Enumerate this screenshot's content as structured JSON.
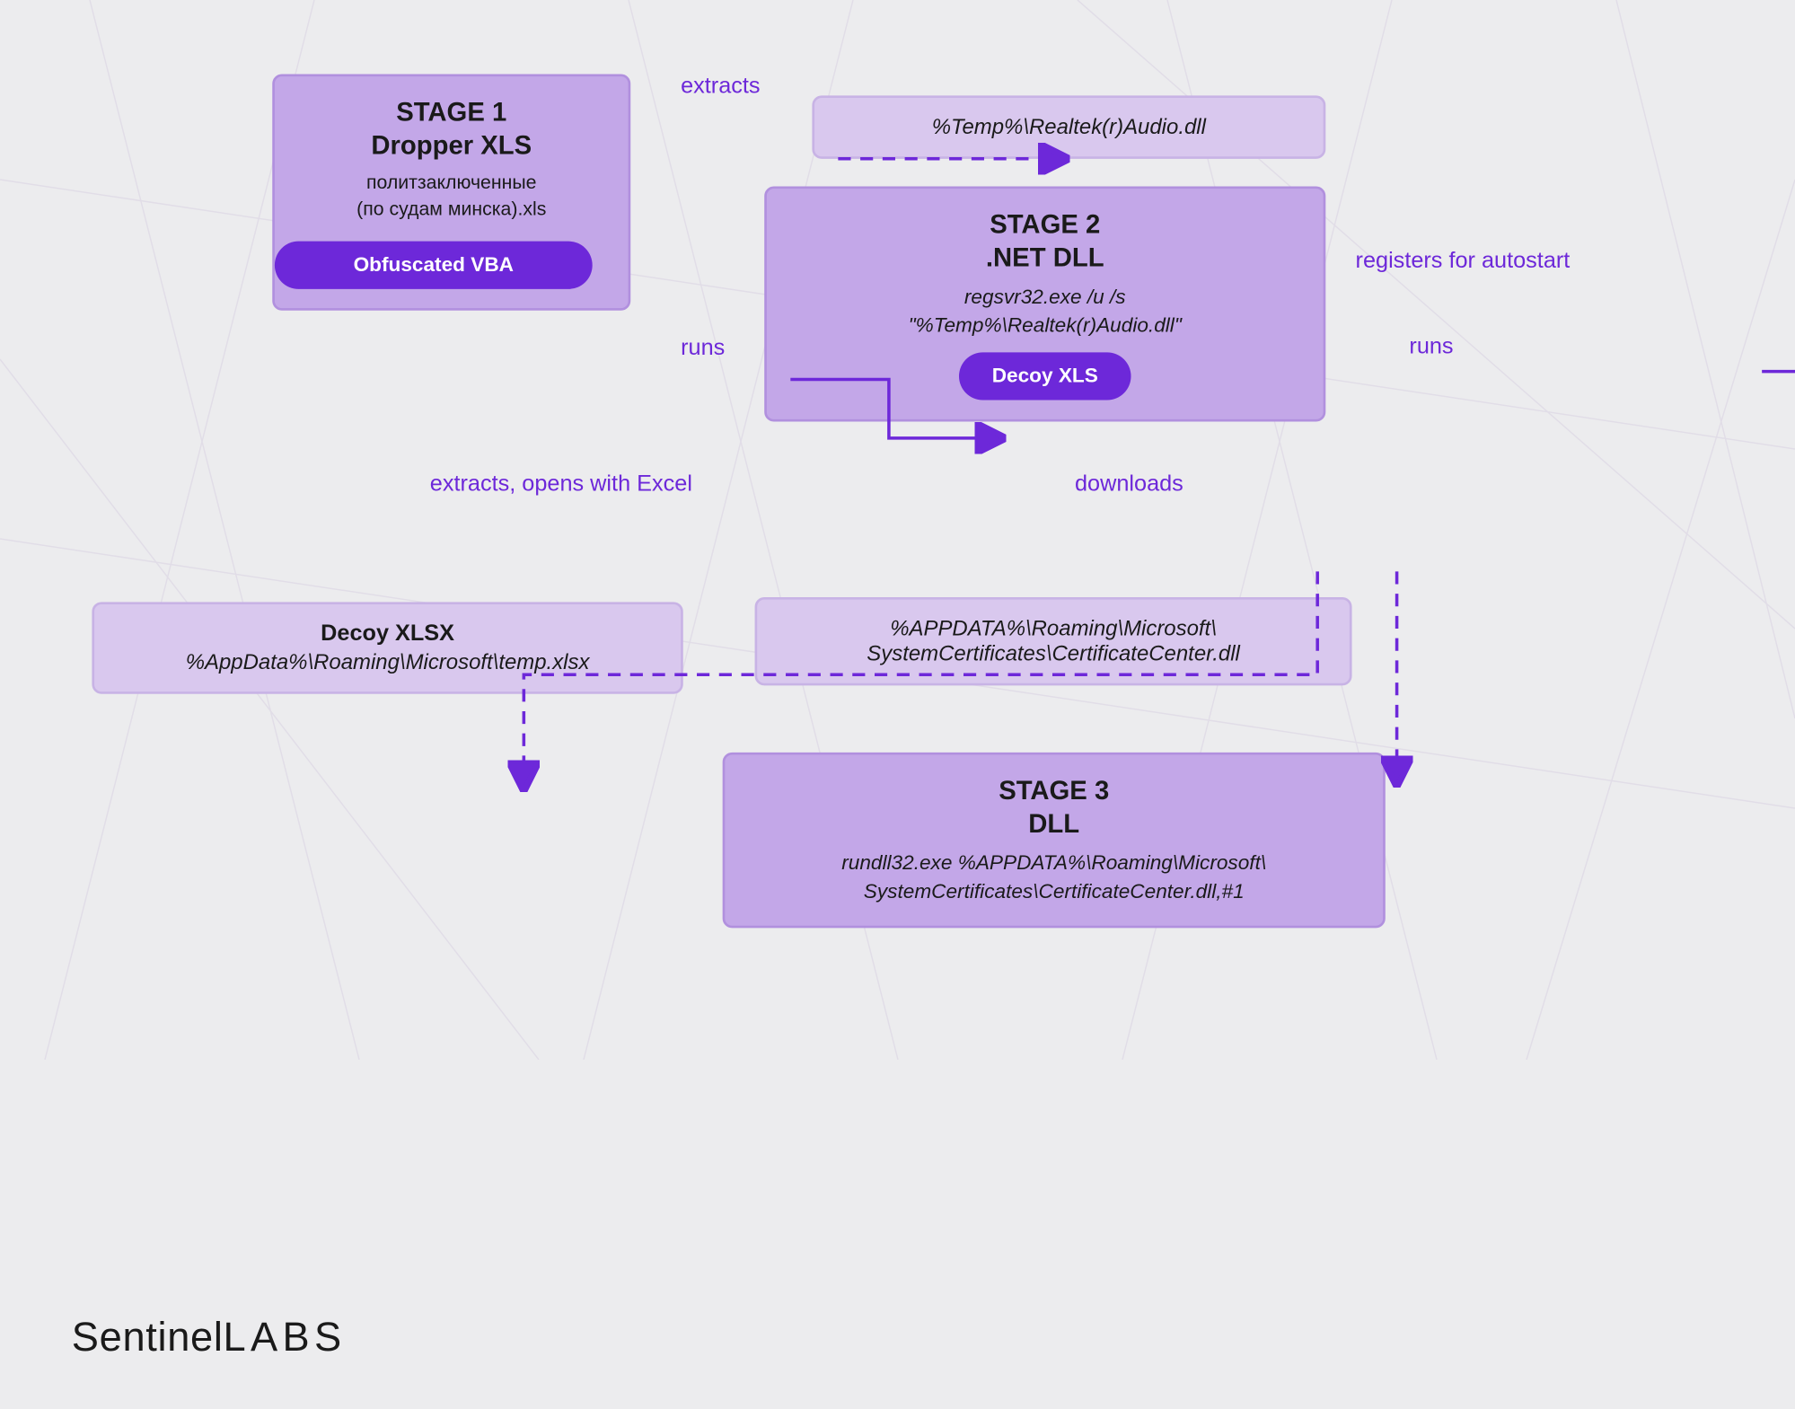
{
  "stage1": {
    "title_line1": "STAGE 1",
    "title_line2": "Dropper XLS",
    "sub_line1": "политзаключенные",
    "sub_line2": "(по судам минска).xls",
    "pill": "Obfuscated VBA"
  },
  "box_realtek": {
    "text": "%Temp%\\Realtek(r)Audio.dll"
  },
  "stage2": {
    "title_line1": "STAGE 2",
    "title_line2": ".NET DLL",
    "sub_line1": "regsvr32.exe /u /s",
    "sub_line2": "\"%Temp%\\Realtek(r)Audio.dll\"",
    "pill": "Decoy XLS"
  },
  "box_decoy_xlsx": {
    "title": "Decoy XLSX",
    "path": "%AppData%\\Roaming\\Microsoft\\temp.xlsx"
  },
  "box_appdata": {
    "line1": "%APPDATA%\\Roaming\\Microsoft\\",
    "line2": "SystemCertificates\\CertificateCenter.dll"
  },
  "stage3": {
    "title_line1": "STAGE 3",
    "title_line2": "DLL",
    "sub_line1": "rundll32.exe %APPDATA%\\Roaming\\Microsoft\\",
    "sub_line2": "SystemCertificates\\CertificateCenter.dll,#1"
  },
  "edges": {
    "extracts": "extracts",
    "runs1": "runs",
    "extracts_opens": "extracts, opens with Excel",
    "downloads": "downloads",
    "registers": "registers for autostart",
    "runs2": "runs"
  },
  "logo": {
    "sentinel": "Sentinel",
    "labs": "LABS"
  }
}
